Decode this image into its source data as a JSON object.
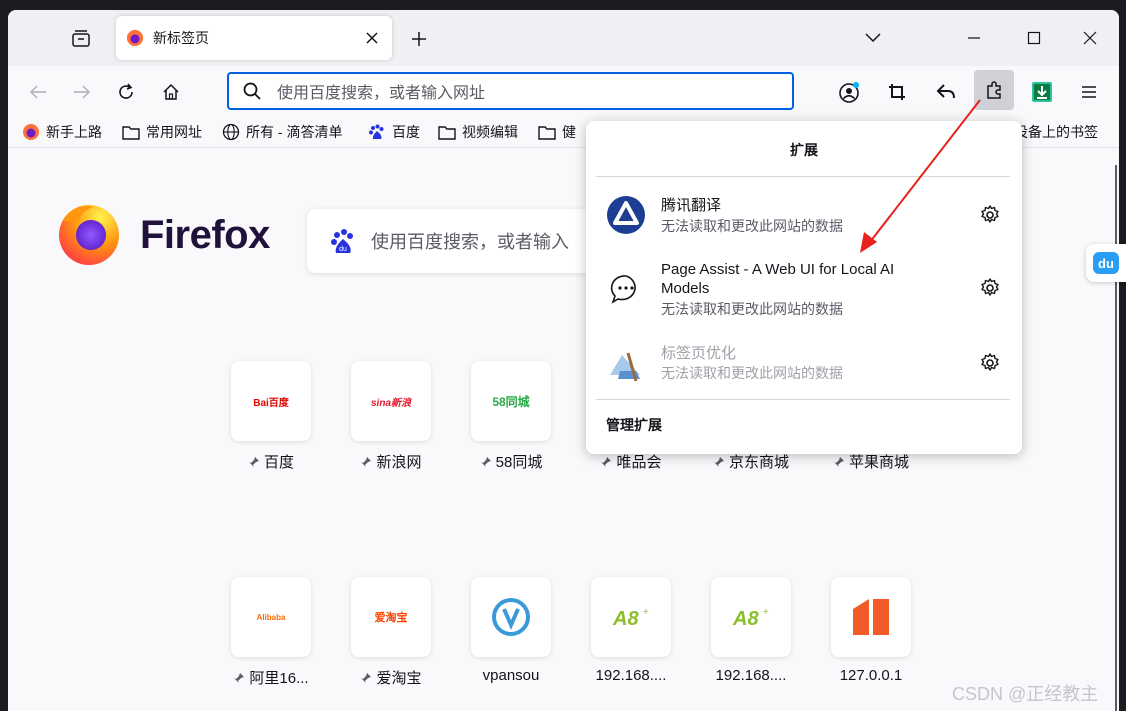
{
  "tabs": [
    {
      "title": "新标签页"
    }
  ],
  "urlbar": {
    "placeholder": "使用百度搜索，或者输入网址"
  },
  "bookmarks": [
    {
      "label": "新手上路",
      "icon": "firefox-icon"
    },
    {
      "label": "常用网址",
      "icon": "folder-icon"
    },
    {
      "label": "所有 - 滴答清单",
      "icon": "globe-icon"
    },
    {
      "label": "百度",
      "icon": "baidu-icon"
    },
    {
      "label": "视频编辑",
      "icon": "folder-icon"
    },
    {
      "label": "健",
      "icon": "folder-icon"
    }
  ],
  "bookmarks_other": "设备上的书签",
  "newtab": {
    "wordmark": "Firefox",
    "search_placeholder": "使用百度搜索，或者输入"
  },
  "top_sites": [
    {
      "label": "百度",
      "pinned": true,
      "logo_text": "Bai百度"
    },
    {
      "label": "新浪网",
      "pinned": true,
      "logo_text": "sina新浪"
    },
    {
      "label": "58同城",
      "pinned": true,
      "logo_text": "58同城"
    },
    {
      "label": "唯品会",
      "pinned": true
    },
    {
      "label": "京东商城",
      "pinned": true
    },
    {
      "label": "苹果商城",
      "pinned": true
    },
    {
      "label": "阿里16...",
      "pinned": true,
      "logo_text": "Alibaba"
    },
    {
      "label": "爱淘宝",
      "pinned": true,
      "logo_text": "爱淘宝"
    },
    {
      "label": "vpansou",
      "pinned": false
    },
    {
      "label": "192.168....",
      "pinned": false
    },
    {
      "label": "192.168....",
      "pinned": false
    },
    {
      "label": "127.0.0.1",
      "pinned": false
    }
  ],
  "extensions_panel": {
    "title": "扩展",
    "items": [
      {
        "name": "腾讯翻译",
        "desc": "无法读取和更改此网站的数据",
        "disabled": false
      },
      {
        "name": "Page Assist - A Web UI for Local AI Models",
        "desc": "无法读取和更改此网站的数据",
        "disabled": false
      },
      {
        "name": "标签页优化",
        "desc": "无法读取和更改此网站的数据",
        "disabled": true
      }
    ],
    "manage_label": "管理扩展"
  },
  "watermark": "CSDN @正经教主",
  "colors": {
    "accent": "#0061e0",
    "arrow": "#e8231e",
    "download": "#2ac3a2"
  }
}
